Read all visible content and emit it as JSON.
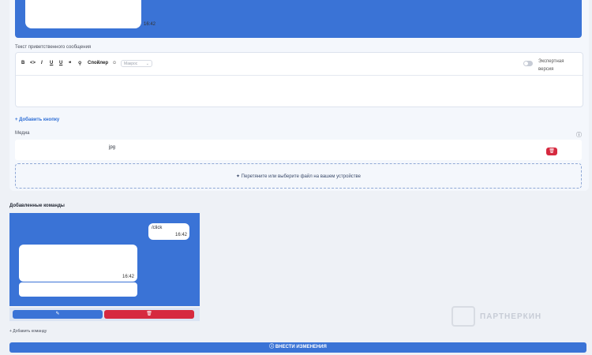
{
  "top_preview": {
    "time": "16:42"
  },
  "welcome": {
    "label": "Текст приветственного сообщения",
    "toolbar": {
      "bold": "B",
      "code": "<>",
      "italic": "I",
      "underline": "U",
      "underline2": "U",
      "quote": "❝",
      "link": "⚲",
      "spoiler": "Спойлер",
      "emoji": "☺",
      "macros_placeholder": "Макрос"
    },
    "expert_label": "Экспертная версия"
  },
  "add_button": "+ Добавить кнопку",
  "media": {
    "label": "Медиа",
    "file_name": "jpg",
    "dropzone_text": "Перетяните или выберите файл на вашем устройстве"
  },
  "commands": {
    "title": "Добавленные команды",
    "user_message": "/click",
    "user_time": "16:42",
    "bot_time": "16:42"
  },
  "add_command": "+ Добавить команду",
  "watermark": "ПАРТНЕРКИН",
  "submit": "ⓘ ВНЕСТИ ИЗМЕНЕНИЯ",
  "colors": {
    "accent": "#3a73d6",
    "danger": "#d6293f"
  }
}
